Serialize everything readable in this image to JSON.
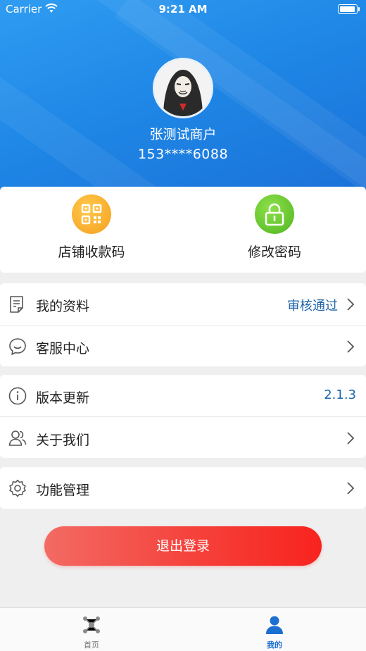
{
  "status_bar": {
    "carrier": "Carrier",
    "time": "9:21 AM"
  },
  "profile": {
    "name": "张测试商户",
    "phone": "153****6088"
  },
  "quick_actions": [
    {
      "label": "店铺收款码",
      "icon": "qr-code-icon",
      "color": "#f5a623"
    },
    {
      "label": "修改密码",
      "icon": "lock-icon",
      "color": "#5cc22e"
    }
  ],
  "menu_group_1": [
    {
      "label": "我的资料",
      "value": "审核通过",
      "icon": "document-icon"
    },
    {
      "label": "客服中心",
      "value": "",
      "icon": "chat-icon"
    }
  ],
  "menu_group_2": [
    {
      "label": "版本更新",
      "value": "2.1.3",
      "icon": "info-icon"
    },
    {
      "label": "关于我们",
      "value": "",
      "icon": "users-icon"
    }
  ],
  "menu_group_3": [
    {
      "label": "功能管理",
      "value": "",
      "icon": "gear-icon"
    }
  ],
  "logout_label": "退出登录",
  "tabbar": [
    {
      "label": "首页",
      "icon": "home-network-icon",
      "active": false
    },
    {
      "label": "我的",
      "icon": "person-icon",
      "active": true
    }
  ],
  "colors": {
    "accent_blue": "#1d63a8",
    "logout_red": "#f5413a",
    "header_blue": "#2f8ff0"
  }
}
